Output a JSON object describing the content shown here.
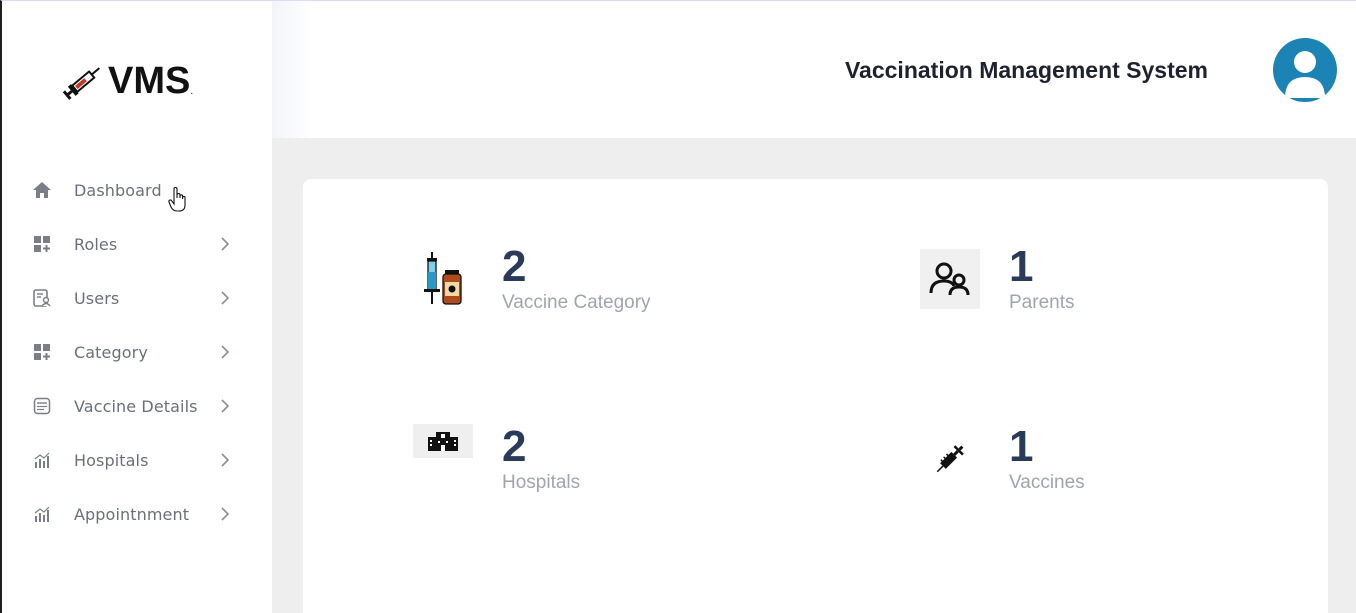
{
  "app": {
    "logo_text": "VMS",
    "logo_dot": ".",
    "title": "Vaccination Management System"
  },
  "sidebar": {
    "items": [
      {
        "label": "Dashboard",
        "icon": "home-icon",
        "has_chevron": false
      },
      {
        "label": "Roles",
        "icon": "widgets-icon",
        "has_chevron": true
      },
      {
        "label": "Users",
        "icon": "user-list-icon",
        "has_chevron": true
      },
      {
        "label": "Category",
        "icon": "widgets-icon",
        "has_chevron": true
      },
      {
        "label": "Vaccine Details",
        "icon": "calendar-icon",
        "has_chevron": true
      },
      {
        "label": "Hospitals",
        "icon": "bar-chart-icon",
        "has_chevron": true
      },
      {
        "label": "Appointnment",
        "icon": "bar-chart-icon",
        "has_chevron": true
      }
    ]
  },
  "stats": [
    {
      "value": "2",
      "label": "Vaccine Category",
      "icon": "vaccine-vial-icon"
    },
    {
      "value": "1",
      "label": "Parents",
      "icon": "parents-icon"
    },
    {
      "value": "2",
      "label": "Hospitals",
      "icon": "hospital-icon"
    },
    {
      "value": "1",
      "label": "Vaccines",
      "icon": "syringe-icon"
    }
  ],
  "colors": {
    "accent": "#1c84b4",
    "stat_number": "#2a3a5a",
    "stat_label": "#a0a4ad",
    "nav_text": "#6b6f7a",
    "main_bg": "#eeeeee"
  }
}
